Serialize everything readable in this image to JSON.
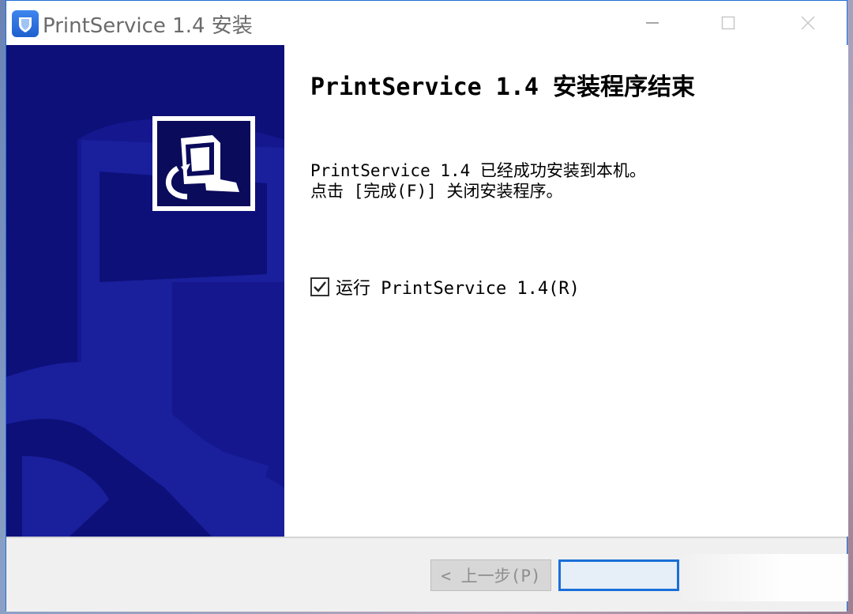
{
  "window": {
    "title": "PrintService 1.4 安装",
    "minimize_label": "",
    "maximize_label": "",
    "close_label": ""
  },
  "icons": {
    "app": "installer-shield-icon",
    "minimize": "minimize-icon",
    "maximize": "maximize-icon",
    "close": "close-icon",
    "banner_logo": "computer-install-icon",
    "checkbox": "check-icon"
  },
  "content": {
    "heading": "PrintService 1.4 安装程序结束",
    "line1": "PrintService 1.4 已经成功安装到本机。",
    "line2": "点击 [完成(F)] 关闭安装程序。",
    "run_checkbox": {
      "label": "运行 PrintService 1.4(R)",
      "checked": true
    }
  },
  "footer": {
    "back_label": "< 上一步(P)",
    "finish_label": ""
  },
  "colors": {
    "banner_bg": "#0d1079",
    "banner_shape": "#1a1f9c",
    "accent": "#1a6fd8"
  }
}
